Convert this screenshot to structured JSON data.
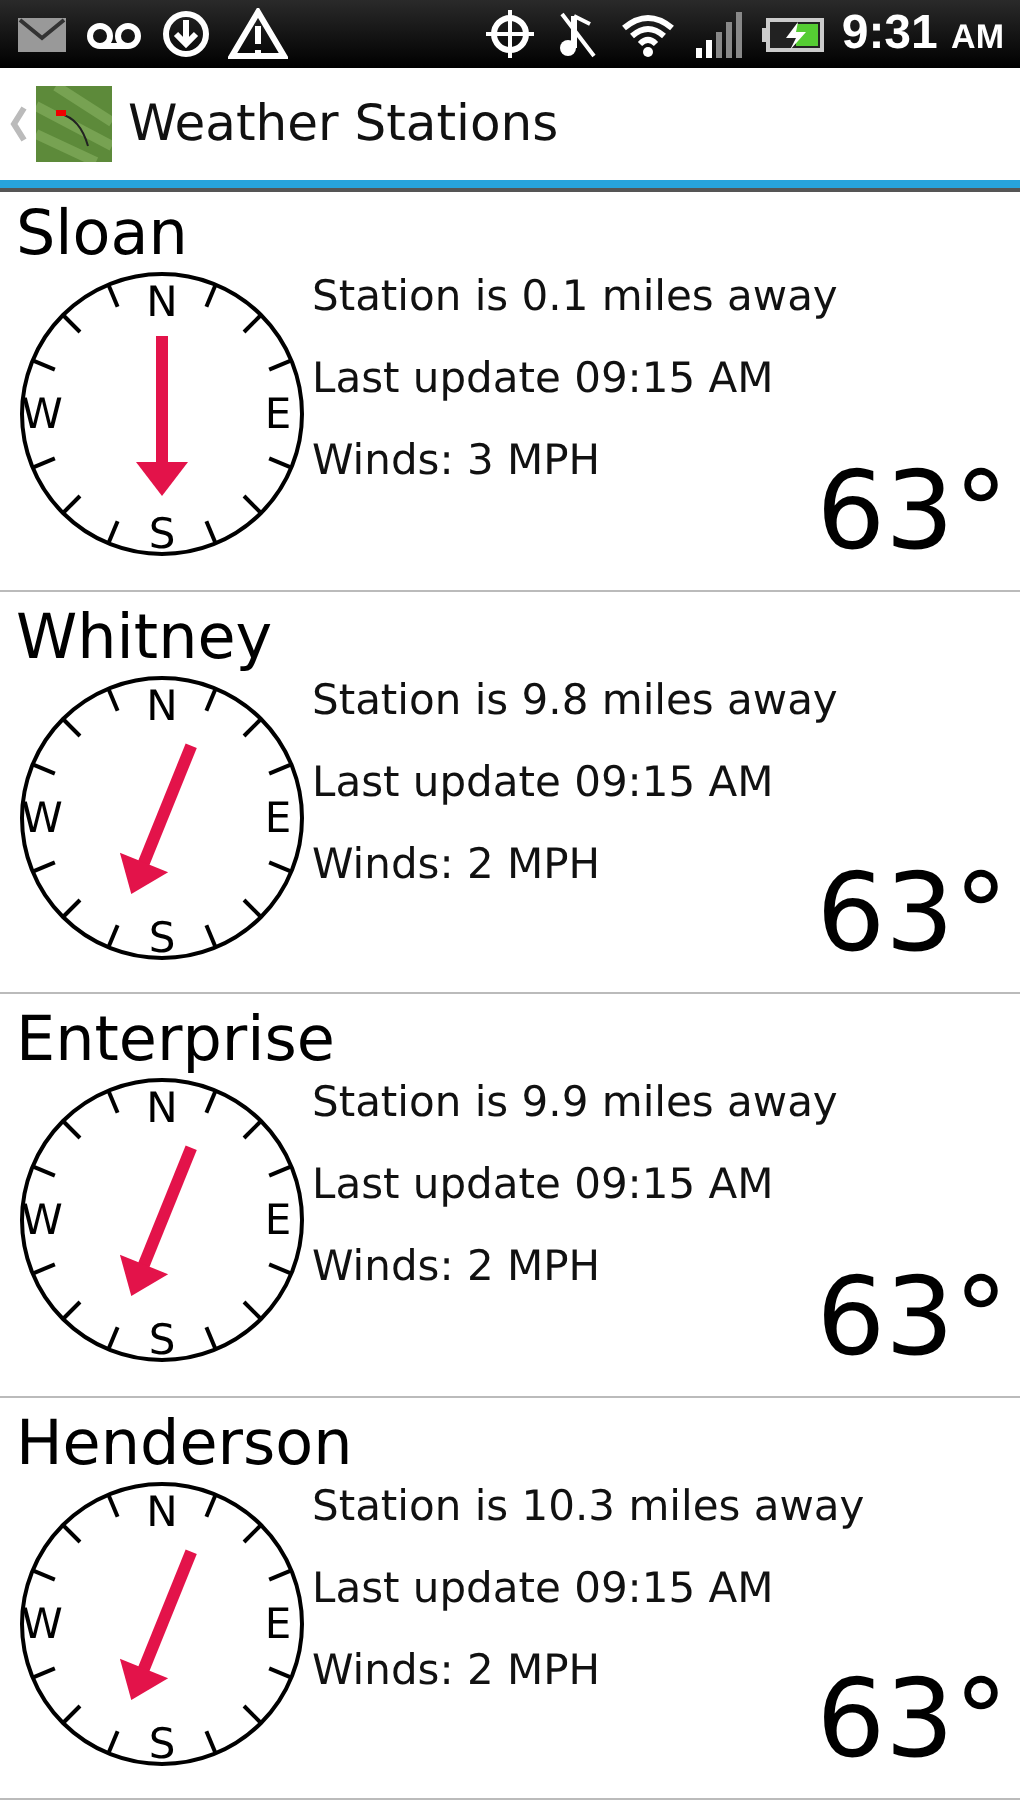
{
  "status_bar": {
    "time": "9:31",
    "ampm": "AM"
  },
  "header": {
    "title": "Weather Stations"
  },
  "stations": [
    {
      "name": "Sloan",
      "distance": "Station is 0.1 miles away",
      "updated": "Last update 09:15 AM",
      "winds": "Winds: 3 MPH",
      "temperature": "63°",
      "kind": "vertical",
      "compass": [
        "N",
        "E",
        "S",
        "W"
      ]
    },
    {
      "name": "Whitney",
      "distance": "Station is 9.8 miles away",
      "updated": "Last update 09:15 AM",
      "winds": "Winds: 2 MPH",
      "temperature": "63°",
      "kind": "tilted",
      "compass": [
        "N",
        "E",
        "S",
        "W"
      ]
    },
    {
      "name": "Enterprise",
      "distance": "Station is 9.9 miles away",
      "updated": "Last update 09:15 AM",
      "winds": "Winds: 2 MPH",
      "temperature": "63°",
      "kind": "tilted",
      "compass": [
        "N",
        "E",
        "S",
        "W"
      ]
    },
    {
      "name": "Henderson",
      "distance": "Station is 10.3 miles away",
      "updated": "Last update 09:15 AM",
      "winds": "Winds: 2 MPH",
      "temperature": "63°",
      "kind": "tilted",
      "compass": [
        "N",
        "E",
        "S",
        "W"
      ]
    }
  ]
}
